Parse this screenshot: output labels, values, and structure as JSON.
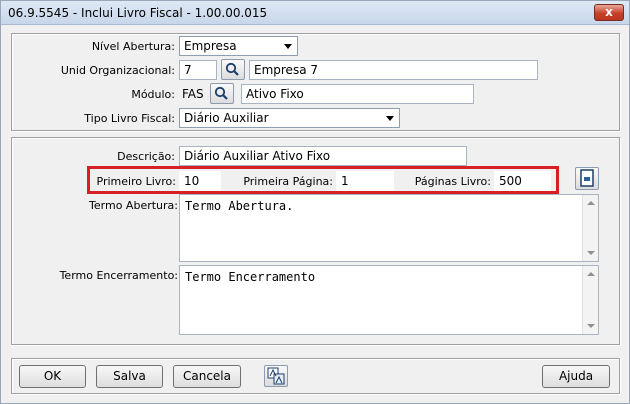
{
  "window": {
    "title": "06.9.5545 - Inclui Livro Fiscal - 1.00.00.015",
    "close_glyph": "x"
  },
  "form": {
    "nivel_abertura": {
      "label": "Nível Abertura:",
      "value": "Empresa"
    },
    "unid_organizacional": {
      "label": "Unid Organizacional:",
      "code": "7",
      "name": "Empresa 7"
    },
    "modulo": {
      "label": "Módulo:",
      "code": "FAS",
      "name": "Ativo Fixo"
    },
    "tipo_livro_fiscal": {
      "label": "Tipo Livro Fiscal:",
      "value": "Diário Auxiliar"
    },
    "descricao": {
      "label": "Descrição:",
      "value": "Diário Auxiliar Ativo Fixo"
    },
    "primeiro_livro": {
      "label": "Primeiro Livro:",
      "value": "10"
    },
    "primeira_pagina": {
      "label": "Primeira Página:",
      "value": "1"
    },
    "paginas_livro": {
      "label": "Páginas Livro:",
      "value": "500"
    },
    "termo_abertura": {
      "label": "Termo Abertura:",
      "value": "Termo Abertura."
    },
    "termo_encerramento": {
      "label": "Termo Encerramento:",
      "value": "Termo Encerramento"
    }
  },
  "buttons": {
    "ok": "OK",
    "salva": "Salva",
    "cancela": "Cancela",
    "ajuda": "Ajuda"
  },
  "icons": {
    "search": "magnifier-icon",
    "page": "page-edit-icon",
    "font": "font-size-icon"
  },
  "colors": {
    "highlight": "#d81f26",
    "close": "#c7412c"
  }
}
